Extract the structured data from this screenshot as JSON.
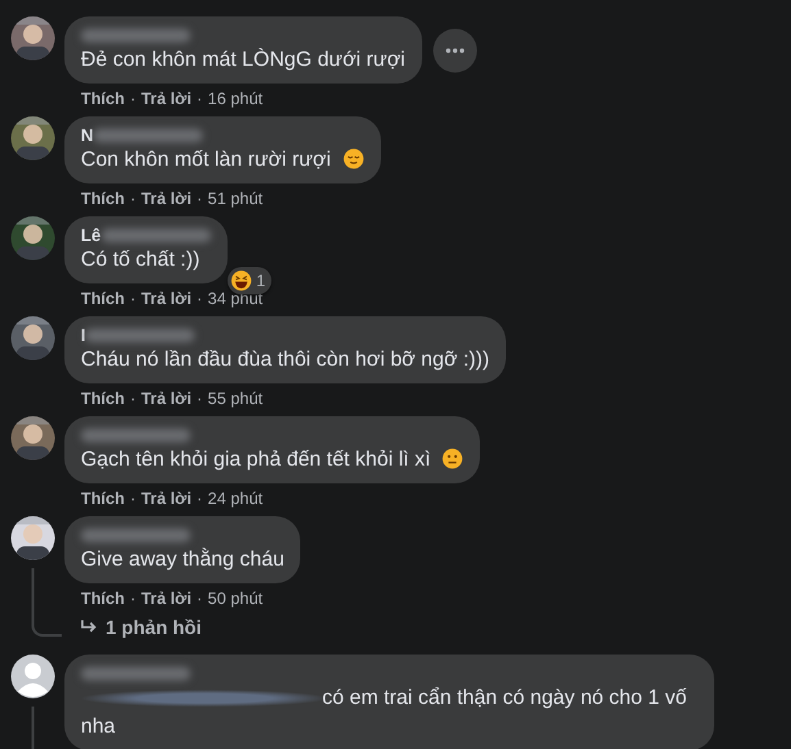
{
  "separator": "·",
  "comments": [
    {
      "avatar": {
        "kind": "photo"
      },
      "text": "Đẻ con khôn mát LÒNgG dưới rượi",
      "more_button": true,
      "like": "Thích",
      "reply": "Trả lời",
      "time": "16 phút"
    },
    {
      "avatar": {
        "kind": "photo"
      },
      "name_prefix": "N",
      "text": "Con khôn mốt làn rười rượi",
      "emoji": {
        "kind": "relieved"
      },
      "like": "Thích",
      "reply": "Trả lời",
      "time": "51 phút"
    },
    {
      "avatar": {
        "kind": "photo"
      },
      "name_prefix": "Lê",
      "text": "Có tố chất :))",
      "reaction": {
        "icon": {
          "kind": "laughing"
        },
        "count": "1"
      },
      "like": "Thích",
      "reply": "Trả lời",
      "time": "34 phút"
    },
    {
      "avatar": {
        "kind": "photo"
      },
      "name_prefix": "I",
      "text": "Cháu nó lần đầu đùa thôi còn hơi bỡ ngỡ :)))",
      "like": "Thích",
      "reply": "Trả lời",
      "time": "55 phút"
    },
    {
      "avatar": {
        "kind": "photo"
      },
      "text": "Gạch tên khỏi gia phả đến tết khỏi lì xì",
      "emoji": {
        "kind": "neutral"
      },
      "like": "Thích",
      "reply": "Trả lời",
      "time": "24 phút"
    },
    {
      "avatar": {
        "kind": "photo"
      },
      "text": "Give away thằng cháu",
      "like": "Thích",
      "reply": "Trả lời",
      "time": "50 phút",
      "replies": "1 phản hồi"
    },
    {
      "avatar": {
        "kind": "default"
      },
      "text_blurred_prefix": true,
      "text": "có em trai cẩn thận có ngày nó cho 1 vố nha"
    }
  ]
}
